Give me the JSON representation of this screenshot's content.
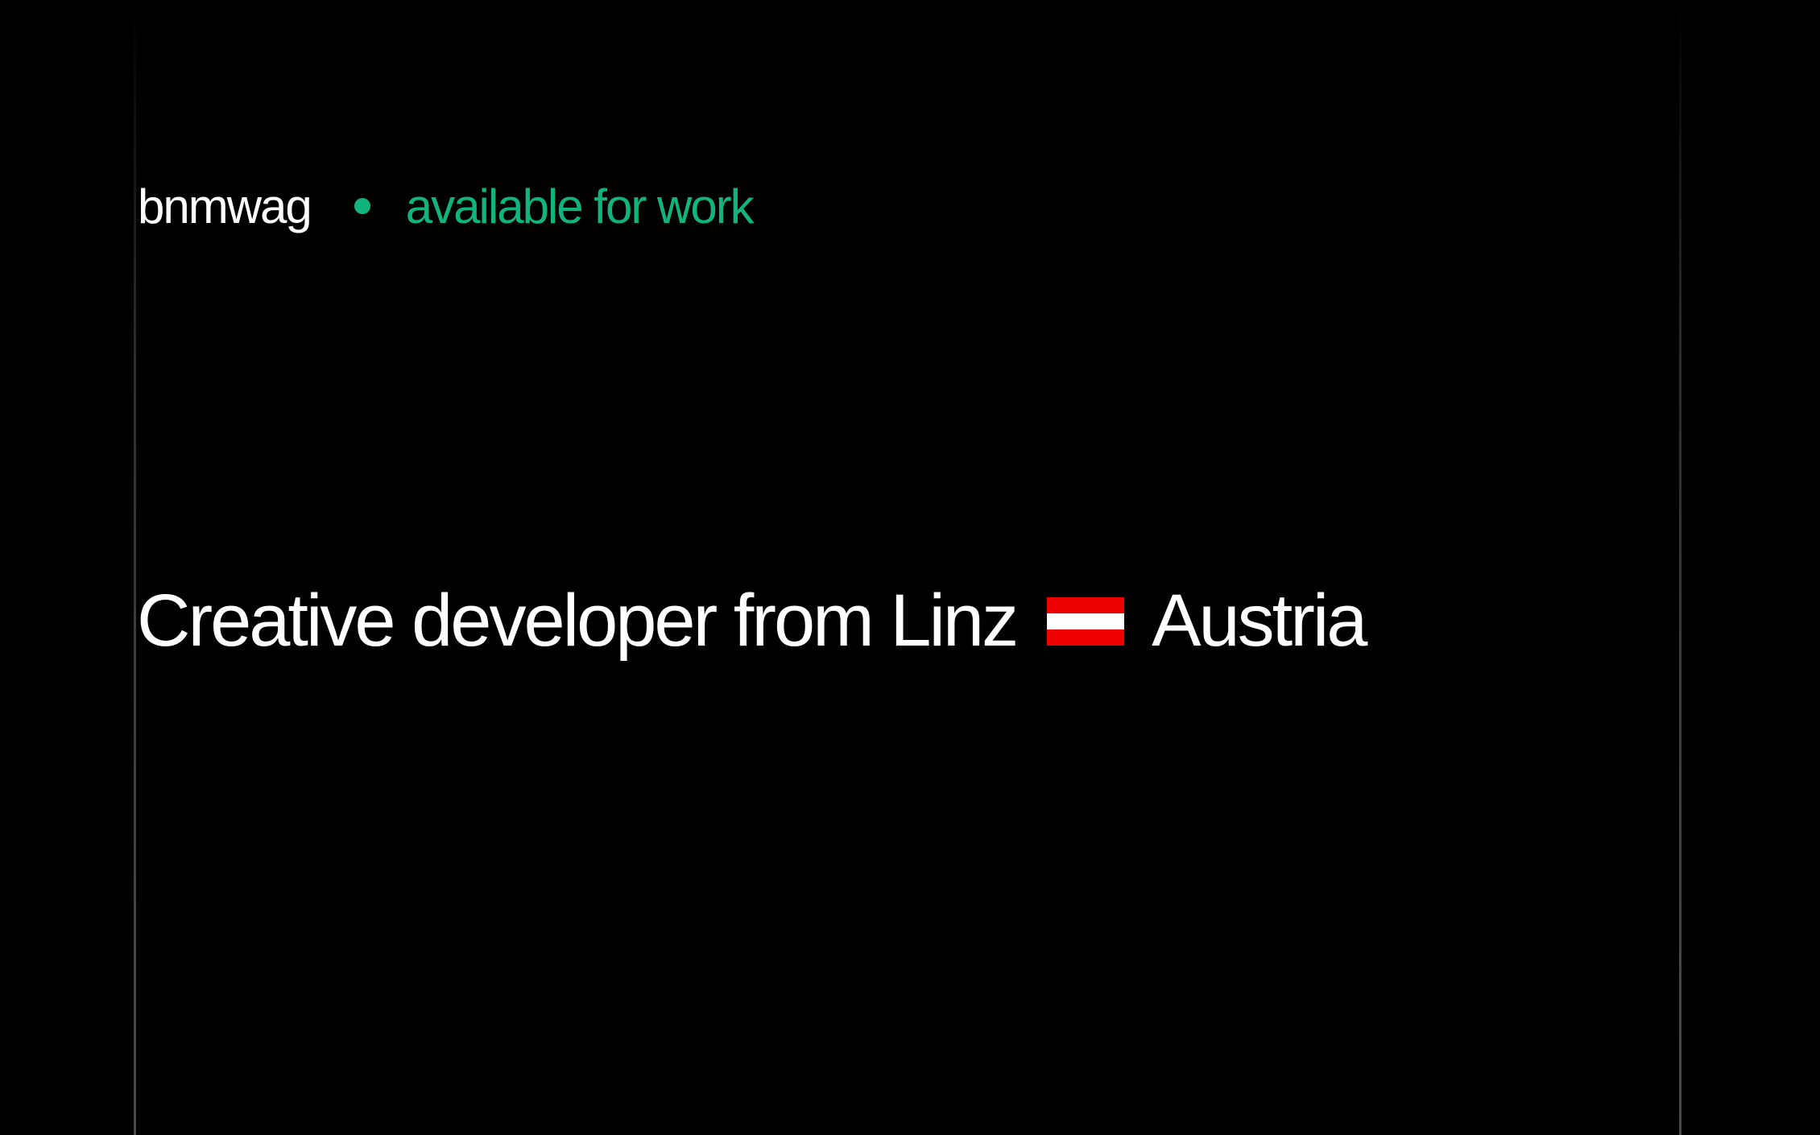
{
  "header": {
    "brand": "bnmwag",
    "status_text": "available for work"
  },
  "hero": {
    "text_before_flag": "Creative developer from Linz",
    "flag_icon": "austria-flag-icon",
    "text_after_flag": "Austria"
  },
  "colors": {
    "background": "#000000",
    "text": "#ffffff",
    "status_accent": "#12b47e",
    "flag_red": "#ef0000",
    "flag_white": "#ffffff"
  }
}
